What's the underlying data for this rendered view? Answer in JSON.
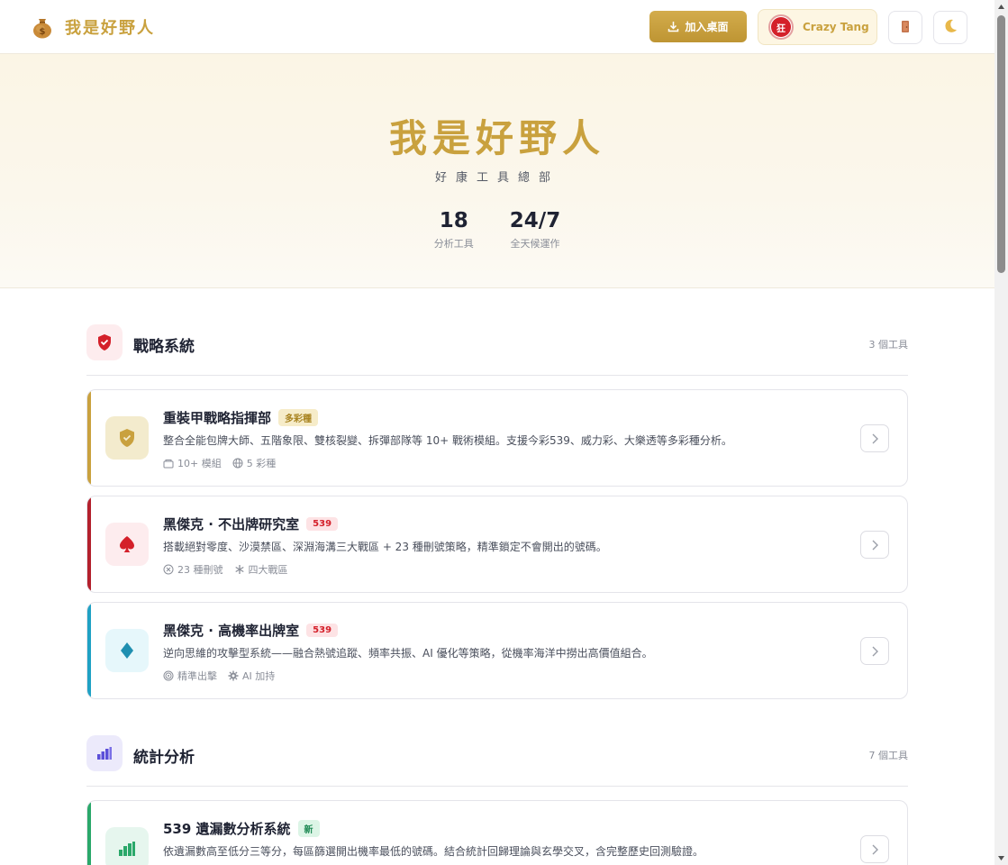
{
  "header": {
    "brand_title": "我是好野人",
    "install_label": "加入桌面",
    "user_name": "Crazy Tang",
    "user_avatar_text": "狂"
  },
  "hero": {
    "title": "我是好野人",
    "subtitle": "好康工具總部",
    "stats": [
      {
        "value": "18",
        "label": "分析工具"
      },
      {
        "value": "24/7",
        "label": "全天候運作"
      }
    ]
  },
  "sections": [
    {
      "title": "戰略系統",
      "count": "3 個工具",
      "icon": "shield-icon",
      "cards": [
        {
          "title": "重裝甲戰略指揮部",
          "badge": "多彩種",
          "desc": "整合全能包牌大師、五階象限、雙核裂變、拆彈部隊等 10+ 戰術模組。支援今彩539、威力彩、大樂透等多彩種分析。",
          "meta": [
            "10+ 模組",
            "5 彩種"
          ],
          "accent": "#c9a13e"
        },
        {
          "title": "黑傑克 · 不出牌研究室",
          "badge": "539",
          "desc": "搭載絕對零度、沙漠禁區、深淵海溝三大戰區 + 23 種刪號策略，精準鎖定不會開出的號碼。",
          "meta": [
            "23 種刪號",
            "四大戰區"
          ],
          "accent": "#b3202c"
        },
        {
          "title": "黑傑克 · 高機率出牌室",
          "badge": "539",
          "desc": "逆向思維的攻擊型系統——融合熱號追蹤、頻率共振、AI 優化等策略，從機率海洋中撈出高價值組合。",
          "meta": [
            "精準出擊",
            "AI 加持"
          ],
          "accent": "#1fa1c4"
        }
      ]
    },
    {
      "title": "統計分析",
      "count": "7 個工具",
      "icon": "bar-chart-icon",
      "cards": [
        {
          "title": "539 遺漏數分析系統",
          "badge": "新",
          "desc": "依遺漏數高至低分三等分，每區篩選開出機率最低的號碼。結合統計回歸理論與玄學交叉，含完整歷史回測驗證。",
          "accent": "#2aa86a"
        }
      ]
    }
  ],
  "colors": {
    "gold": "#c9a13e",
    "red": "#d4202a",
    "teal": "#1fa1c4",
    "green": "#2aa86a",
    "purple": "#5b4fd8"
  }
}
